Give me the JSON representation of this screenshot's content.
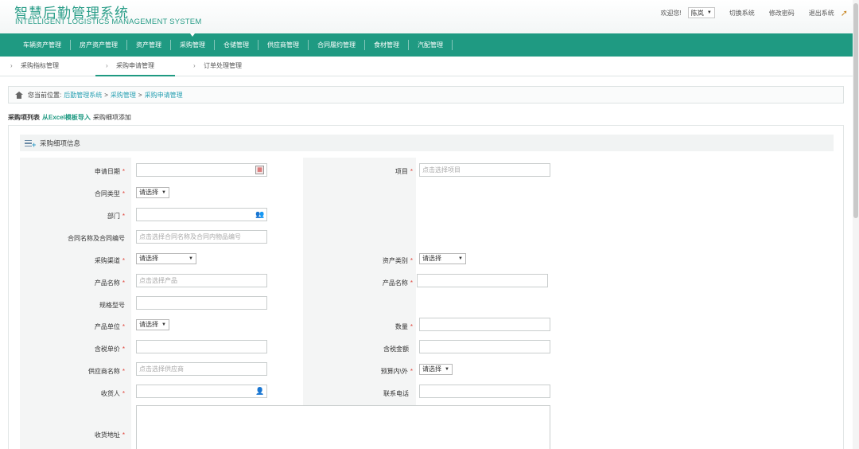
{
  "header": {
    "title_cn": "智慧后勤管理系统",
    "title_en": "INTELLIGENT LOGISTICS MANAGEMENT SYSTEM",
    "welcome": "欢迎您!",
    "user": "陈岚",
    "switch_system": "切换系统",
    "change_password": "修改密码",
    "logout": "退出系统"
  },
  "nav": {
    "items": [
      "车辆资产管理",
      "房产资产管理",
      "资产管理",
      "采购管理",
      "仓储管理",
      "供应商管理",
      "合同履约管理",
      "食材管理",
      "汽配管理"
    ]
  },
  "subnav": {
    "items": [
      "采购指标管理",
      "采购申请管理",
      "订单处理管理"
    ]
  },
  "breadcrumb": {
    "label": "您当前位置:",
    "items": [
      "后勤管理系统",
      "采购管理",
      "采购申请管理"
    ],
    "sep": ">"
  },
  "toolbar": {
    "list": "采购项列表",
    "excel": "从Excel模板导入",
    "add": "采购细项添加"
  },
  "panel": {
    "title": "采购细项信息"
  },
  "form": {
    "required_mark": "*",
    "apply_date": "申请日期",
    "project": "项目",
    "project_ph": "点击选择项目",
    "contract_type": "合同类型",
    "select_default": "请选择",
    "department": "部门",
    "contract_name_no": "合同名称及合同编号",
    "contract_ph": "点击选择合同名称及合同内物品编号",
    "purchase_channel": "采购渠道",
    "asset_category": "资产类别",
    "product_name": "产品名称",
    "product_ph": "点击选择产品",
    "product_name2": "产品名称",
    "spec_model": "规格型号",
    "product_unit": "产品单位",
    "quantity": "数量",
    "unit_price": "含税单价",
    "amount": "含税金额",
    "supplier_name": "供应商名称",
    "supplier_ph": "点击选择供应商",
    "budget": "预算内\\外",
    "consignee": "收货人",
    "phone": "联系电话",
    "address": "收货地址"
  },
  "icons": {
    "calendar": "calendar-icon",
    "person": "person-icon",
    "home": "home-icon",
    "list": "list-add-icon"
  },
  "colors": {
    "primary": "#1f9a82",
    "link": "#2aa1b3",
    "required": "#e0443b"
  }
}
